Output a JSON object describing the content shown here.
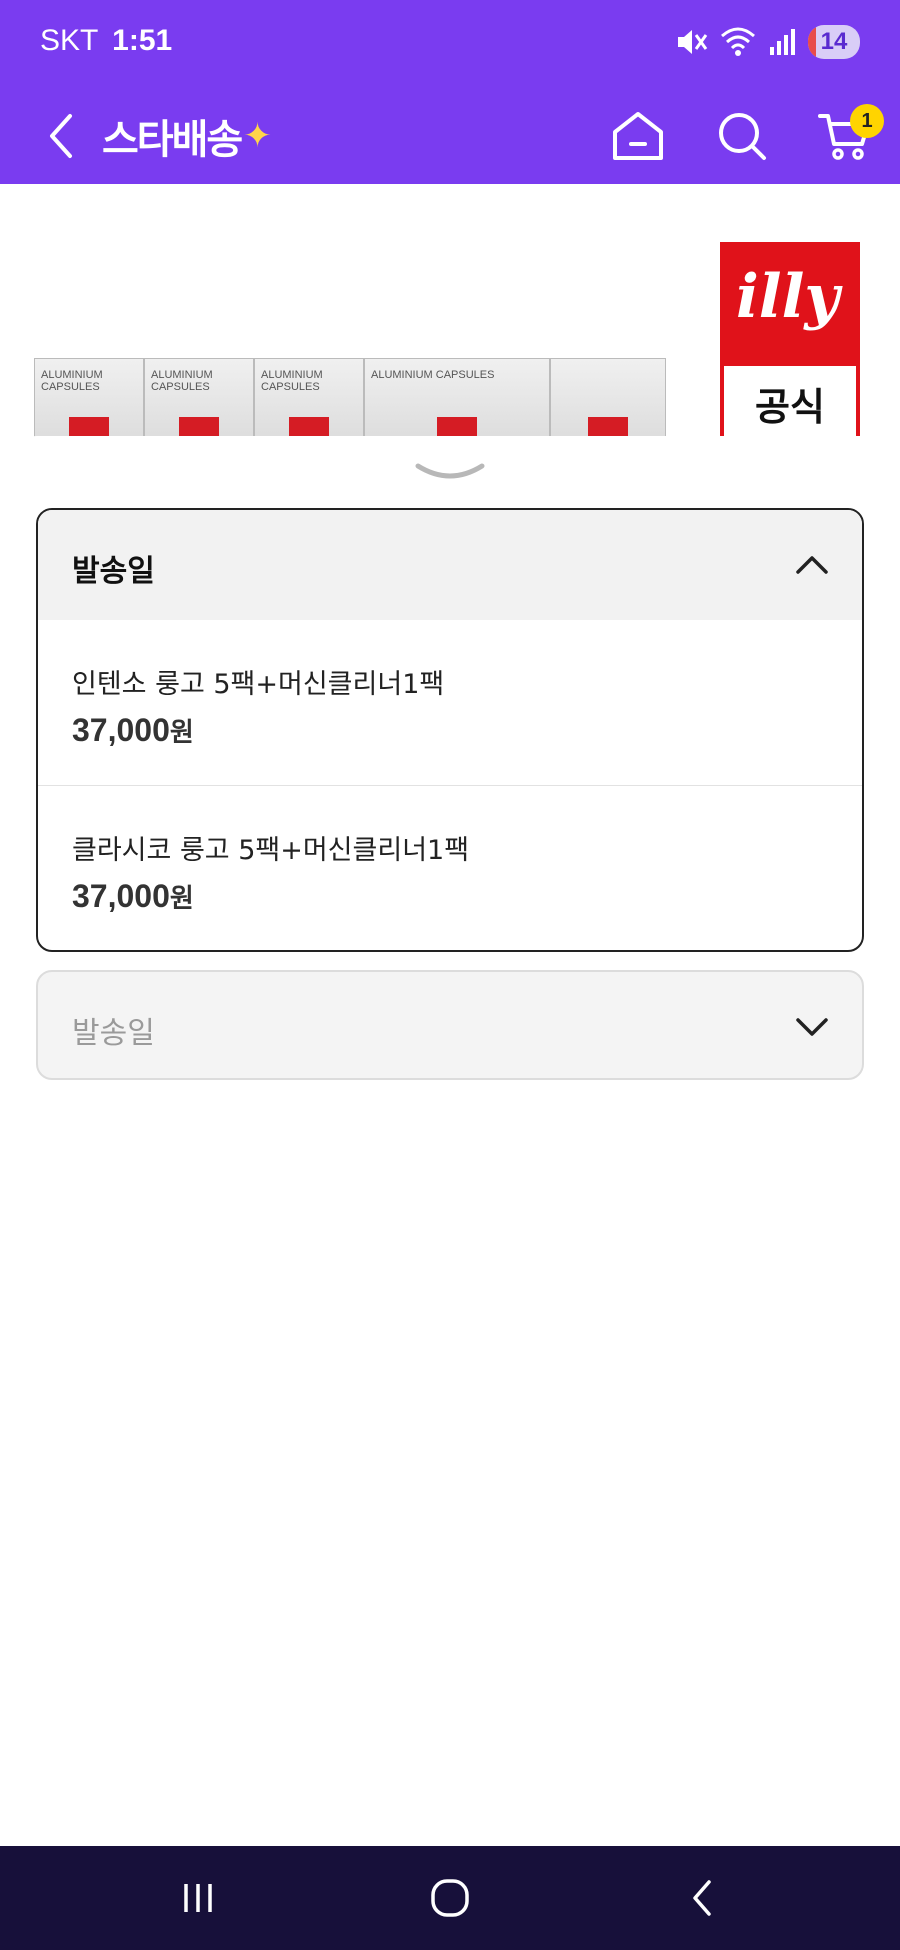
{
  "status_bar": {
    "carrier": "SKT",
    "time": "1:51",
    "battery": "14",
    "icons": [
      "mute-icon",
      "wifi-icon",
      "signal-icon",
      "battery-icon"
    ]
  },
  "app_bar": {
    "brand": "스타배송",
    "cart_count": "1",
    "icons": [
      "back-arrow-icon",
      "home-icon",
      "search-icon",
      "cart-icon"
    ]
  },
  "product_image": {
    "capsule_text": "ALUMINIUM CAPSULES",
    "brand_word": "illy",
    "badge": "공식"
  },
  "option_sheet": {
    "first_select": {
      "title": "발송일",
      "options": [
        {
          "name": "인텐소 룽고 5팩+머신클리너1팩",
          "price": "37,000",
          "currency": "원"
        },
        {
          "name": "클라시코 룽고 5팩+머신클리너1팩",
          "price": "37,000",
          "currency": "원"
        }
      ]
    },
    "second_select": {
      "placeholder": "발송일"
    }
  },
  "colors": {
    "brand_purple": "#7a3cf0",
    "badge_yellow": "#ffd400",
    "illy_red": "#e0121a",
    "nav_dark": "#17103a"
  }
}
